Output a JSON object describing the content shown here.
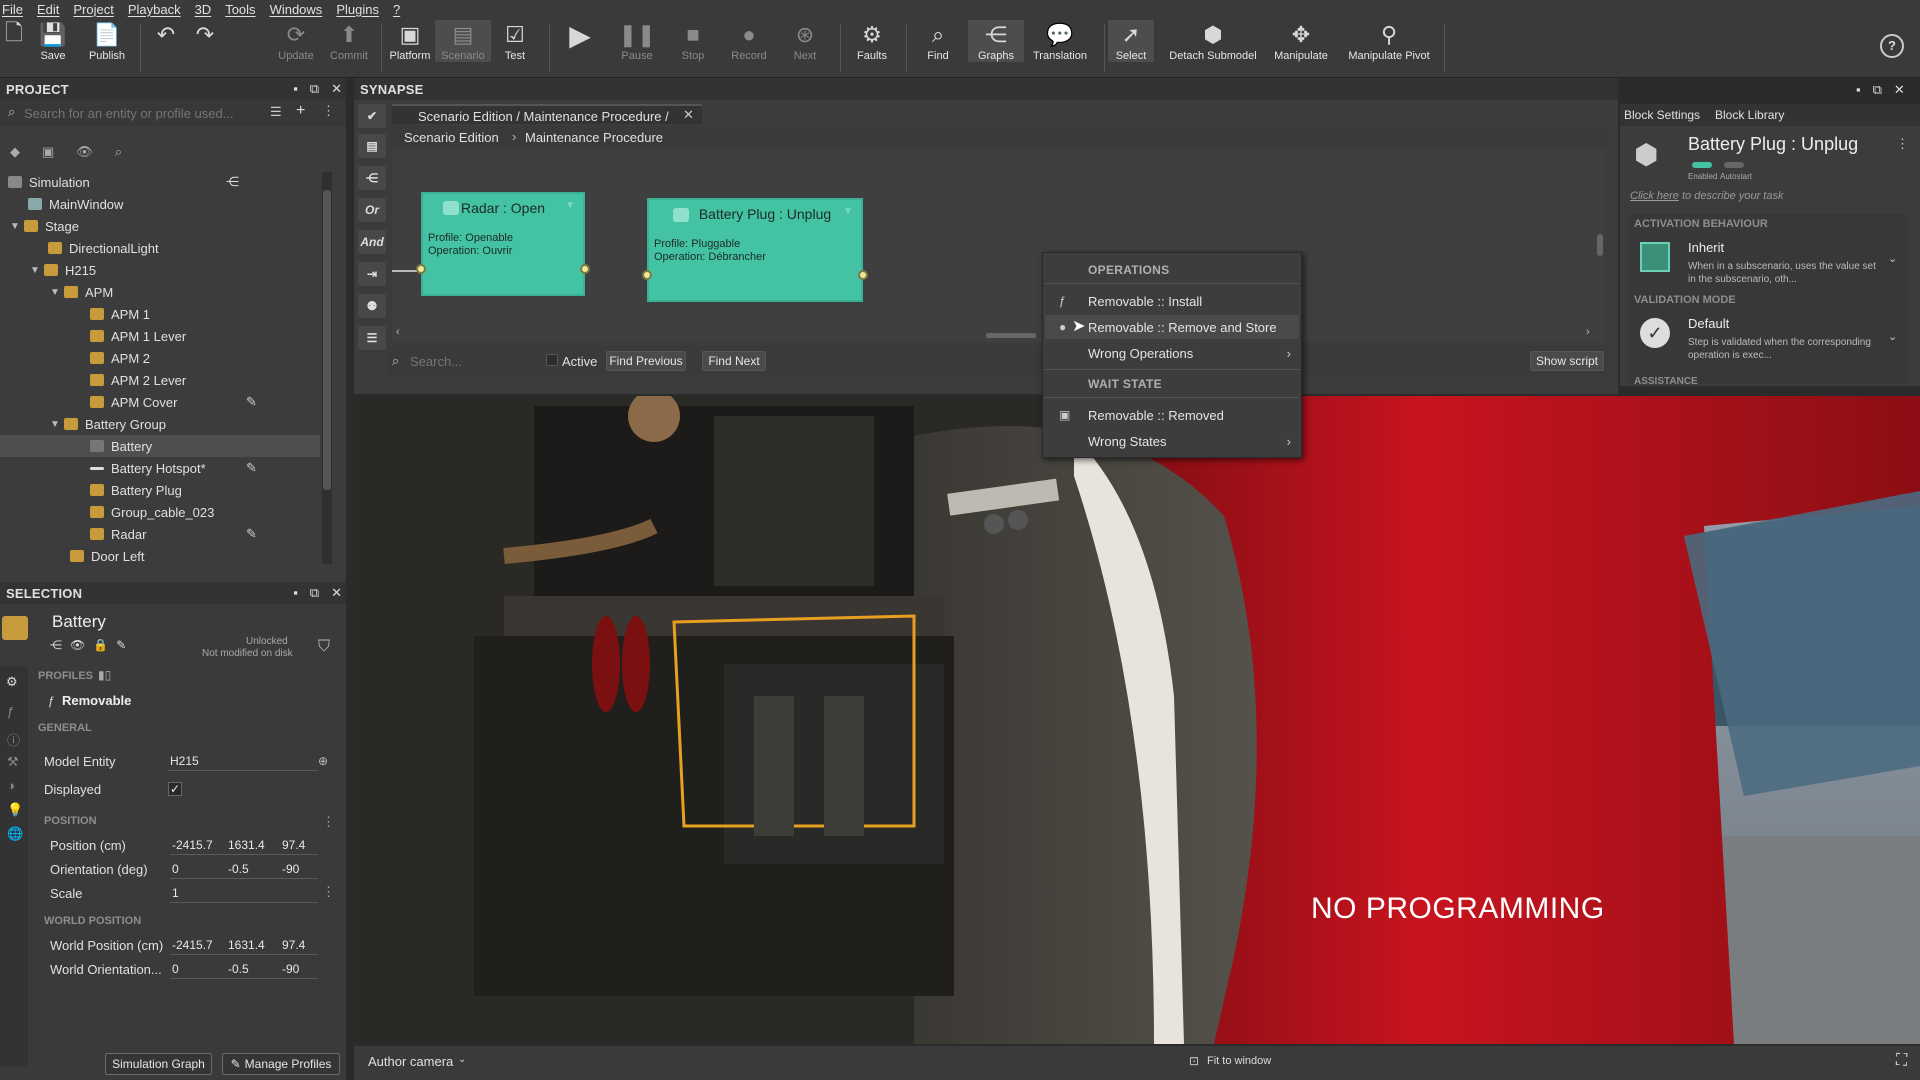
{
  "menubar": [
    "File",
    "Edit",
    "Project",
    "Playback",
    "3D",
    "Tools",
    "Windows",
    "Plugins",
    "?"
  ],
  "toolbar": {
    "items": [
      {
        "label": "",
        "icon": "new-file-icon"
      },
      {
        "label": "Save",
        "icon": "save-icon"
      },
      {
        "label": "Publish",
        "icon": "publish-icon"
      },
      {
        "label": "",
        "icon": "undo-icon"
      },
      {
        "label": "",
        "icon": "redo-icon"
      },
      {
        "label": "Update",
        "icon": "update-icon"
      },
      {
        "label": "Commit",
        "icon": "commit-icon"
      },
      {
        "label": "Platform",
        "icon": "platform-icon"
      },
      {
        "label": "Scenario",
        "icon": "scenario-icon"
      },
      {
        "label": "Test",
        "icon": "test-icon"
      },
      {
        "label": "Pause",
        "icon": "pause-icon"
      },
      {
        "label": "Stop",
        "icon": "stop-icon"
      },
      {
        "label": "Record",
        "icon": "record-icon"
      },
      {
        "label": "Next",
        "icon": "next-icon"
      },
      {
        "label": "Faults",
        "icon": "faults-icon"
      },
      {
        "label": "Find",
        "icon": "find-icon"
      },
      {
        "label": "Graphs",
        "icon": "graphs-icon"
      },
      {
        "label": "Translation",
        "icon": "translation-icon"
      },
      {
        "label": "Select",
        "icon": "select-icon"
      },
      {
        "label": "Detach Submodel",
        "icon": "detach-icon"
      },
      {
        "label": "Manipulate",
        "icon": "manipulate-icon"
      },
      {
        "label": "Manipulate Pivot",
        "icon": "manipulate-pivot-icon"
      }
    ]
  },
  "project": {
    "title": "PROJECT",
    "search_placeholder": "Search for an entity or profile used...",
    "tree": [
      {
        "label": "Simulation"
      },
      {
        "label": "MainWindow"
      },
      {
        "label": "Stage"
      },
      {
        "label": "DirectionalLight"
      },
      {
        "label": "H215"
      },
      {
        "label": "APM"
      },
      {
        "label": "APM 1"
      },
      {
        "label": "APM 1 Lever"
      },
      {
        "label": "APM 2"
      },
      {
        "label": "APM 2 Lever"
      },
      {
        "label": "APM Cover"
      },
      {
        "label": "Battery Group"
      },
      {
        "label": "Battery"
      },
      {
        "label": "Battery Hotspot*"
      },
      {
        "label": "Battery Plug"
      },
      {
        "label": "Group_cable_023"
      },
      {
        "label": "Radar"
      },
      {
        "label": "Door Left"
      }
    ]
  },
  "selection": {
    "title": "SELECTION",
    "entity": "Battery",
    "lock_status": "Unlocked",
    "disk_status": "Not modified on disk",
    "profiles_label": "PROFILES",
    "profile": "Removable",
    "general_label": "GENERAL",
    "model_entity_label": "Model Entity",
    "model_entity": "H215",
    "displayed_label": "Displayed",
    "position_label": "POSITION",
    "position_row": {
      "label": "Position (cm)",
      "x": "-2415.7",
      "y": "1631.4",
      "z": "97.4"
    },
    "orientation_row": {
      "label": "Orientation (deg)",
      "x": "0",
      "y": "-0.5",
      "z": "-90"
    },
    "scale_row": {
      "label": "Scale",
      "x": "1"
    },
    "world_label": "WORLD POSITION",
    "world_position_row": {
      "label": "World Position (cm)",
      "x": "-2415.7",
      "y": "1631.4",
      "z": "97.4"
    },
    "world_orientation_row": {
      "label": "World Orientation...",
      "x": "0",
      "y": "-0.5",
      "z": "-90"
    },
    "sim_graph_button": "Simulation Graph",
    "manage_profiles_button": "Manage Profiles"
  },
  "synapse": {
    "title": "SYNAPSE",
    "tab": "Scenario Edition / Maintenance Procedure /",
    "breadcrumb": [
      "Scenario Edition",
      "Maintenance Procedure"
    ],
    "side_labels": [
      "Or",
      "And"
    ],
    "node1": {
      "title": "Radar : Open",
      "profile": "Profile: Openable",
      "operation": "Operation: Ouvrir"
    },
    "node2": {
      "title": "Battery Plug : Unplug",
      "profile": "Profile: Pluggable",
      "operation": "Operation: Débrancher"
    },
    "search_placeholder": "Search...",
    "active_label": "Active",
    "find_previous": "Find Previous",
    "find_next": "Find Next",
    "show_script": "Show script"
  },
  "context_menu": {
    "operations_header": "OPERATIONS",
    "install": "Removable :: Install",
    "remove_store": "Removable :: Remove and Store",
    "wrong_operations": "Wrong Operations",
    "wait_header": "WAIT STATE",
    "removed": "Removable :: Removed",
    "wrong_states": "Wrong States"
  },
  "block_settings": {
    "tab1": "Block Settings",
    "tab2": "Block Library",
    "title": "Battery Plug : Unplug",
    "enabled": "Enabled",
    "autostart": "Autostart",
    "describe_link": "Click here",
    "describe_rest": "to describe your task",
    "activation_label": "ACTIVATION BEHAVIOUR",
    "activation_value": "Inherit",
    "activation_desc": "When in a subscenario, uses the value set in the subscenario, oth...",
    "validation_label": "VALIDATION MODE",
    "validation_value": "Default",
    "validation_desc": "Step is validated when the corresponding operation is exec...",
    "assistance_label": "ASSISTANCE"
  },
  "viewport": {
    "camera": "Author camera",
    "fit": "Fit to window",
    "caption": "NO PROGRAMMING"
  },
  "colors": {
    "node": "#43c3a4",
    "highlight": "#e8a020",
    "fuselage": "#b5121b"
  }
}
